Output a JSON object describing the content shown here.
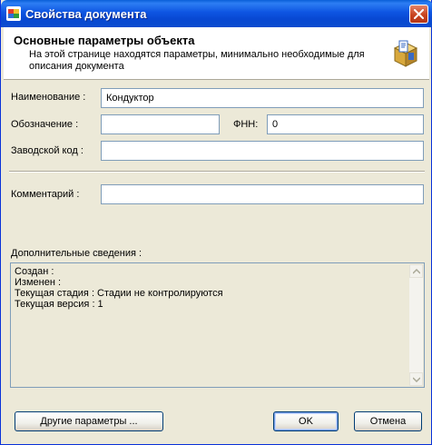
{
  "window": {
    "title": "Свойства документа",
    "close_icon": "close-icon"
  },
  "header": {
    "title": "Основные параметры объекта",
    "description": "На этой странице находятся параметры, минимально необходимые для описания документа",
    "icon": "box-with-document-icon"
  },
  "form": {
    "name_label": "Наименование :",
    "name_value": "Кондуктор",
    "designation_label": "Обозначение :",
    "designation_value": "",
    "fnn_label": "ФНН:",
    "fnn_value": "0",
    "factory_code_label": "Заводской код :",
    "factory_code_value": "",
    "comment_label": "Комментарий :",
    "comment_value": ""
  },
  "info": {
    "label": "Дополнительные сведения :",
    "lines": [
      "Создан :",
      "Изменен :",
      "Текущая стадия : Стадии не контролируются",
      "Текущая версия : 1"
    ]
  },
  "buttons": {
    "other_params": "Другие параметры ...",
    "ok": "OK",
    "cancel": "Отмена"
  },
  "colors": {
    "titlebar": "#0a4ccf",
    "dialog_bg": "#ece9d8",
    "field_border": "#7f9db9",
    "button_border": "#003c74"
  }
}
